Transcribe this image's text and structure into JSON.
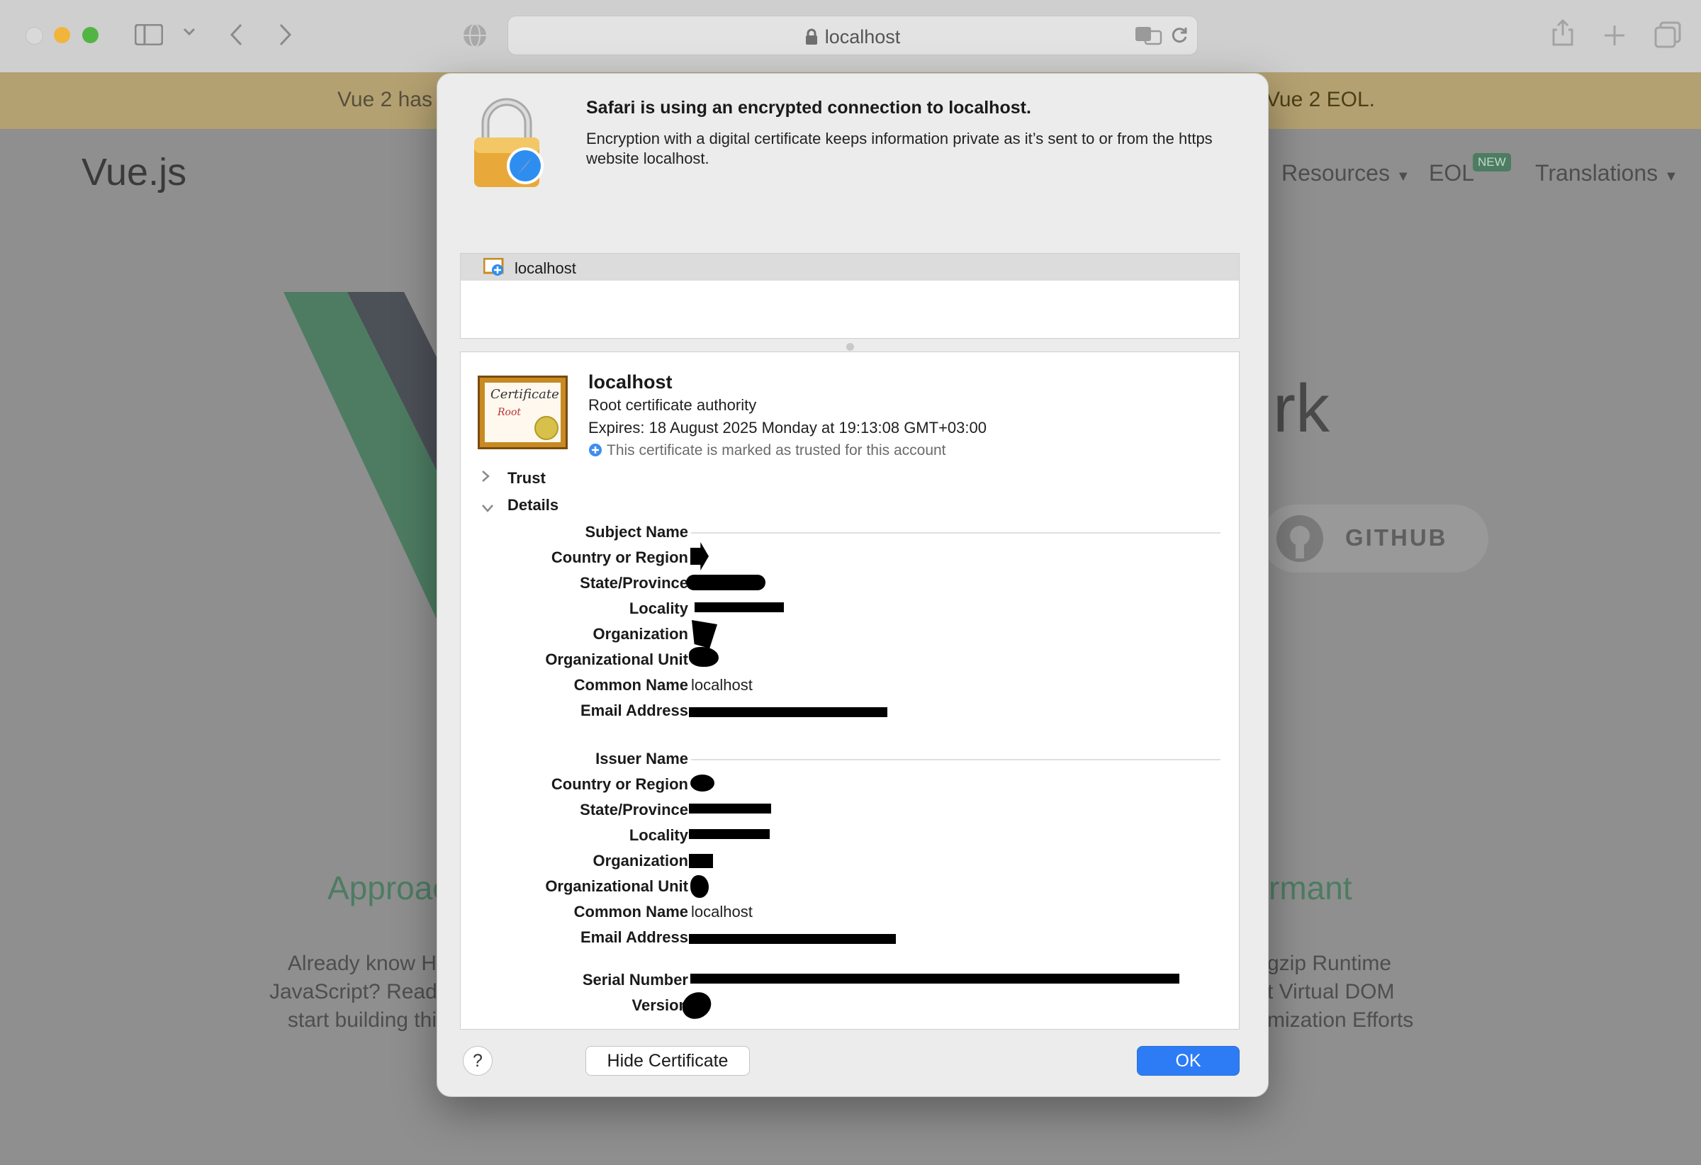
{
  "browser": {
    "address": "localhost",
    "colors": {
      "close": "#d9d9d9",
      "minimize": "#f1b53b",
      "maximize": "#52b543"
    }
  },
  "page_behind": {
    "banner_left": "Vue 2 has r",
    "banner_right": "Vue 2 EOL.",
    "logo": "Vue.js",
    "nav": {
      "resources": "Resources",
      "eol": "EOL",
      "new_badge": "NEW",
      "translations": "Translations"
    },
    "hero_fragment": "rk",
    "github": "GITHUB",
    "approach": "Approac",
    "performant": "rmant",
    "left_lines": [
      "Already know H",
      "JavaScript? Read",
      "start building thi"
    ],
    "right_lines": [
      "gzip Runtime",
      "t Virtual DOM",
      "mization Efforts"
    ]
  },
  "dialog": {
    "title": "Safari is using an encrypted connection to localhost.",
    "description": "Encryption with a digital certificate keeps information private as it’s sent to or from the https website localhost.",
    "chain_item": "localhost",
    "certificate": {
      "name": "localhost",
      "type": "Root certificate authority",
      "expires": "Expires: 18 August 2025 Monday at 19:13:08 GMT+03:00",
      "trust_note": "This certificate is marked as trusted for this account",
      "image_text": {
        "line1": "Certificate",
        "line2": "Root"
      }
    },
    "disclosures": {
      "trust": "Trust",
      "details": "Details"
    },
    "subject": {
      "heading": "Subject Name",
      "country": "Country or Region",
      "state": "State/Province",
      "locality": "Locality",
      "organization": "Organization",
      "org_unit": "Organizational Unit",
      "common_name": "Common Name",
      "common_name_value": "localhost",
      "email": "Email Address"
    },
    "issuer": {
      "heading": "Issuer Name",
      "country": "Country or Region",
      "state": "State/Province",
      "locality": "Locality",
      "organization": "Organization",
      "org_unit": "Organizational Unit",
      "common_name": "Common Name",
      "common_name_value": "localhost",
      "email": "Email Address"
    },
    "serial_number": "Serial Number",
    "version": "Version",
    "buttons": {
      "help": "?",
      "hide_certificate": "Hide Certificate",
      "ok": "OK"
    }
  }
}
